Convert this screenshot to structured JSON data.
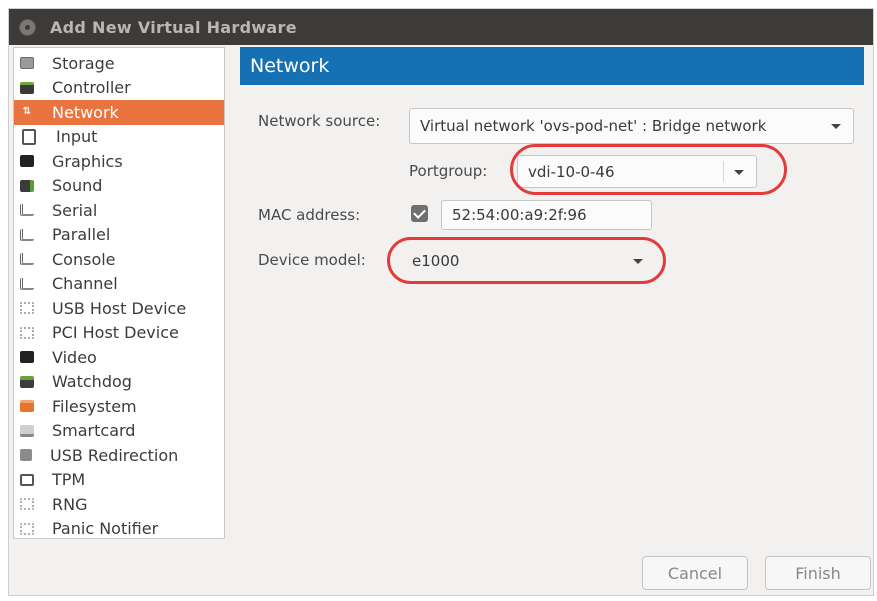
{
  "window": {
    "title": "Add New Virtual Hardware"
  },
  "sidebar": {
    "items": [
      {
        "label": "Storage",
        "icon": "storage-icon"
      },
      {
        "label": "Controller",
        "icon": "controller-icon"
      },
      {
        "label": "Network",
        "icon": "network-icon",
        "selected": true
      },
      {
        "label": "Input",
        "icon": "mouse-icon"
      },
      {
        "label": "Graphics",
        "icon": "monitor-icon"
      },
      {
        "label": "Sound",
        "icon": "sound-card-icon"
      },
      {
        "label": "Serial",
        "icon": "serial-port-icon"
      },
      {
        "label": "Parallel",
        "icon": "parallel-port-icon"
      },
      {
        "label": "Console",
        "icon": "console-port-icon"
      },
      {
        "label": "Channel",
        "icon": "channel-port-icon"
      },
      {
        "label": "USB Host Device",
        "icon": "usb-device-icon"
      },
      {
        "label": "PCI Host Device",
        "icon": "pci-device-icon"
      },
      {
        "label": "Video",
        "icon": "video-icon"
      },
      {
        "label": "Watchdog",
        "icon": "watchdog-icon"
      },
      {
        "label": "Filesystem",
        "icon": "folder-icon"
      },
      {
        "label": "Smartcard",
        "icon": "smartcard-icon"
      },
      {
        "label": "USB Redirection",
        "icon": "usb-redirection-icon"
      },
      {
        "label": "TPM",
        "icon": "tpm-icon"
      },
      {
        "label": "RNG",
        "icon": "rng-icon"
      },
      {
        "label": "Panic Notifier",
        "icon": "panic-notifier-icon"
      }
    ]
  },
  "panel": {
    "title": "Network",
    "network_source_label": "Network source:",
    "network_source_value": "Virtual network 'ovs-pod-net' : Bridge network",
    "portgroup_label": "Portgroup:",
    "portgroup_value": "vdi-10-0-46",
    "mac_label": "MAC address:",
    "mac_checked": true,
    "mac_value": "52:54:00:a9:2f:96",
    "device_model_label": "Device model:",
    "device_model_value": "e1000"
  },
  "buttons": {
    "cancel": "Cancel",
    "finish": "Finish"
  },
  "colors": {
    "header": "#1571b3",
    "selection": "#e9743f",
    "highlight_ring": "#e33b3b",
    "titlebar": "#3c3b37"
  }
}
